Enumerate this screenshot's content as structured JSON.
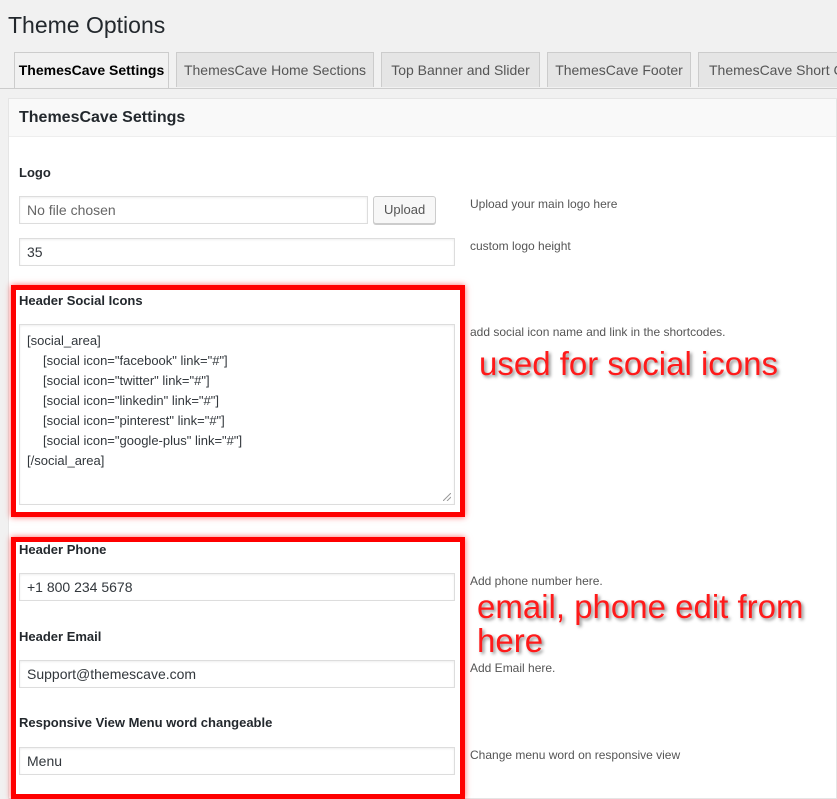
{
  "page": {
    "title": "Theme Options"
  },
  "tabs": [
    {
      "label": "ThemesCave Settings",
      "active": true
    },
    {
      "label": "ThemesCave Home Sections",
      "active": false
    },
    {
      "label": "Top Banner and Slider",
      "active": false
    },
    {
      "label": "ThemesCave Footer",
      "active": false
    },
    {
      "label": "ThemesCave Short C",
      "active": false
    }
  ],
  "panel": {
    "title": "ThemesCave Settings",
    "logo": {
      "label": "Logo",
      "file_placeholder": "No file chosen",
      "upload_label": "Upload",
      "upload_desc": "Upload your main logo here",
      "height_value": "35",
      "height_desc": "custom logo height"
    },
    "social": {
      "label": "Header Social Icons",
      "lines": [
        "[social_area]",
        "[social icon=\"facebook\" link=\"#\"]",
        "[social icon=\"twitter\" link=\"#\"]",
        "[social icon=\"linkedin\" link=\"#\"]",
        "[social icon=\"pinterest\" link=\"#\"]",
        "[social icon=\"google-plus\" link=\"#\"]",
        "[/social_area]"
      ],
      "desc": "add social icon name and link in the shortcodes."
    },
    "phone": {
      "label": "Header Phone",
      "value": "+1 800 234 5678",
      "desc": "Add phone number here."
    },
    "email": {
      "label": "Header Email",
      "value": "Support@themescave.com",
      "desc": "Add Email here."
    },
    "menu_word": {
      "label": "Responsive View Menu word changeable",
      "value": "Menu",
      "desc": "Change menu word on responsive view"
    }
  },
  "annotations": {
    "social": "used for social icons",
    "contact_line1": "email, phone edit from",
    "contact_line2": "here"
  },
  "colors": {
    "highlight": "#ff0000",
    "annotation_text": "#ff1a1a"
  }
}
